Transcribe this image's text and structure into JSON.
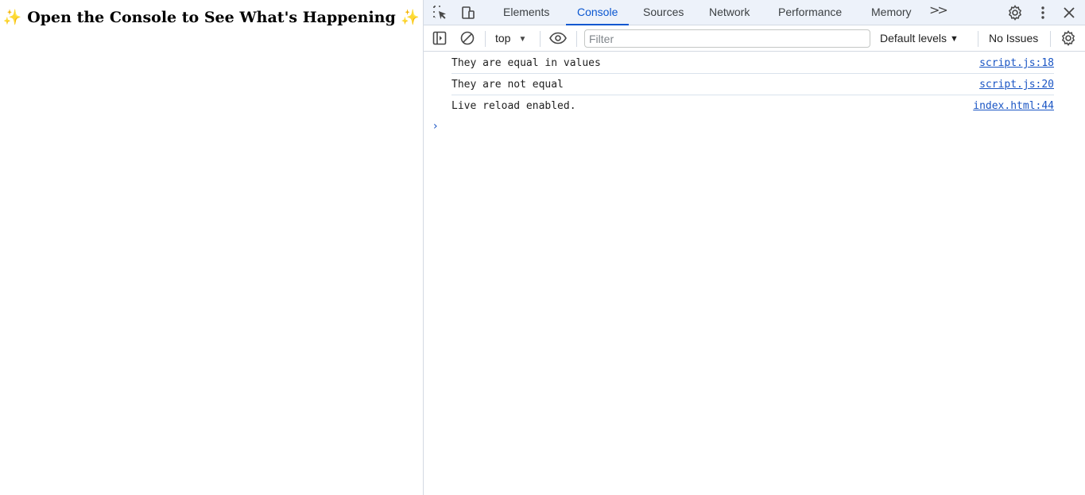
{
  "page": {
    "heading_sparkle_left": "✨",
    "heading_text": "Open the Console to See What's Happening",
    "heading_sparkle_right": "✨"
  },
  "devtools": {
    "tabs": [
      {
        "label": "Elements"
      },
      {
        "label": "Console"
      },
      {
        "label": "Sources"
      },
      {
        "label": "Network"
      },
      {
        "label": "Performance"
      },
      {
        "label": "Memory"
      }
    ],
    "more_tabs": ">>",
    "toolbar": {
      "context": "top",
      "filter_placeholder": "Filter",
      "levels": "Default levels",
      "issues": "No Issues"
    },
    "messages": [
      {
        "text": "They are equal in values",
        "source": "script.js:18"
      },
      {
        "text": "They are not equal",
        "source": "script.js:20"
      },
      {
        "text": "Live reload enabled.",
        "source": "index.html:44"
      }
    ],
    "prompt": "›"
  },
  "icons": {
    "inspect": "inspect-element-icon",
    "device": "device-toolbar-icon",
    "settings": "gear-icon",
    "menu": "kebab-menu-icon",
    "close": "close-icon",
    "sidebar": "sidebar-toggle-icon",
    "clear": "clear-console-icon",
    "eye": "eye-icon",
    "console_settings": "gear-icon"
  },
  "colors": {
    "accent": "#0b57d0",
    "link": "#1a55c4",
    "tabbar_bg": "#edf2fa"
  }
}
